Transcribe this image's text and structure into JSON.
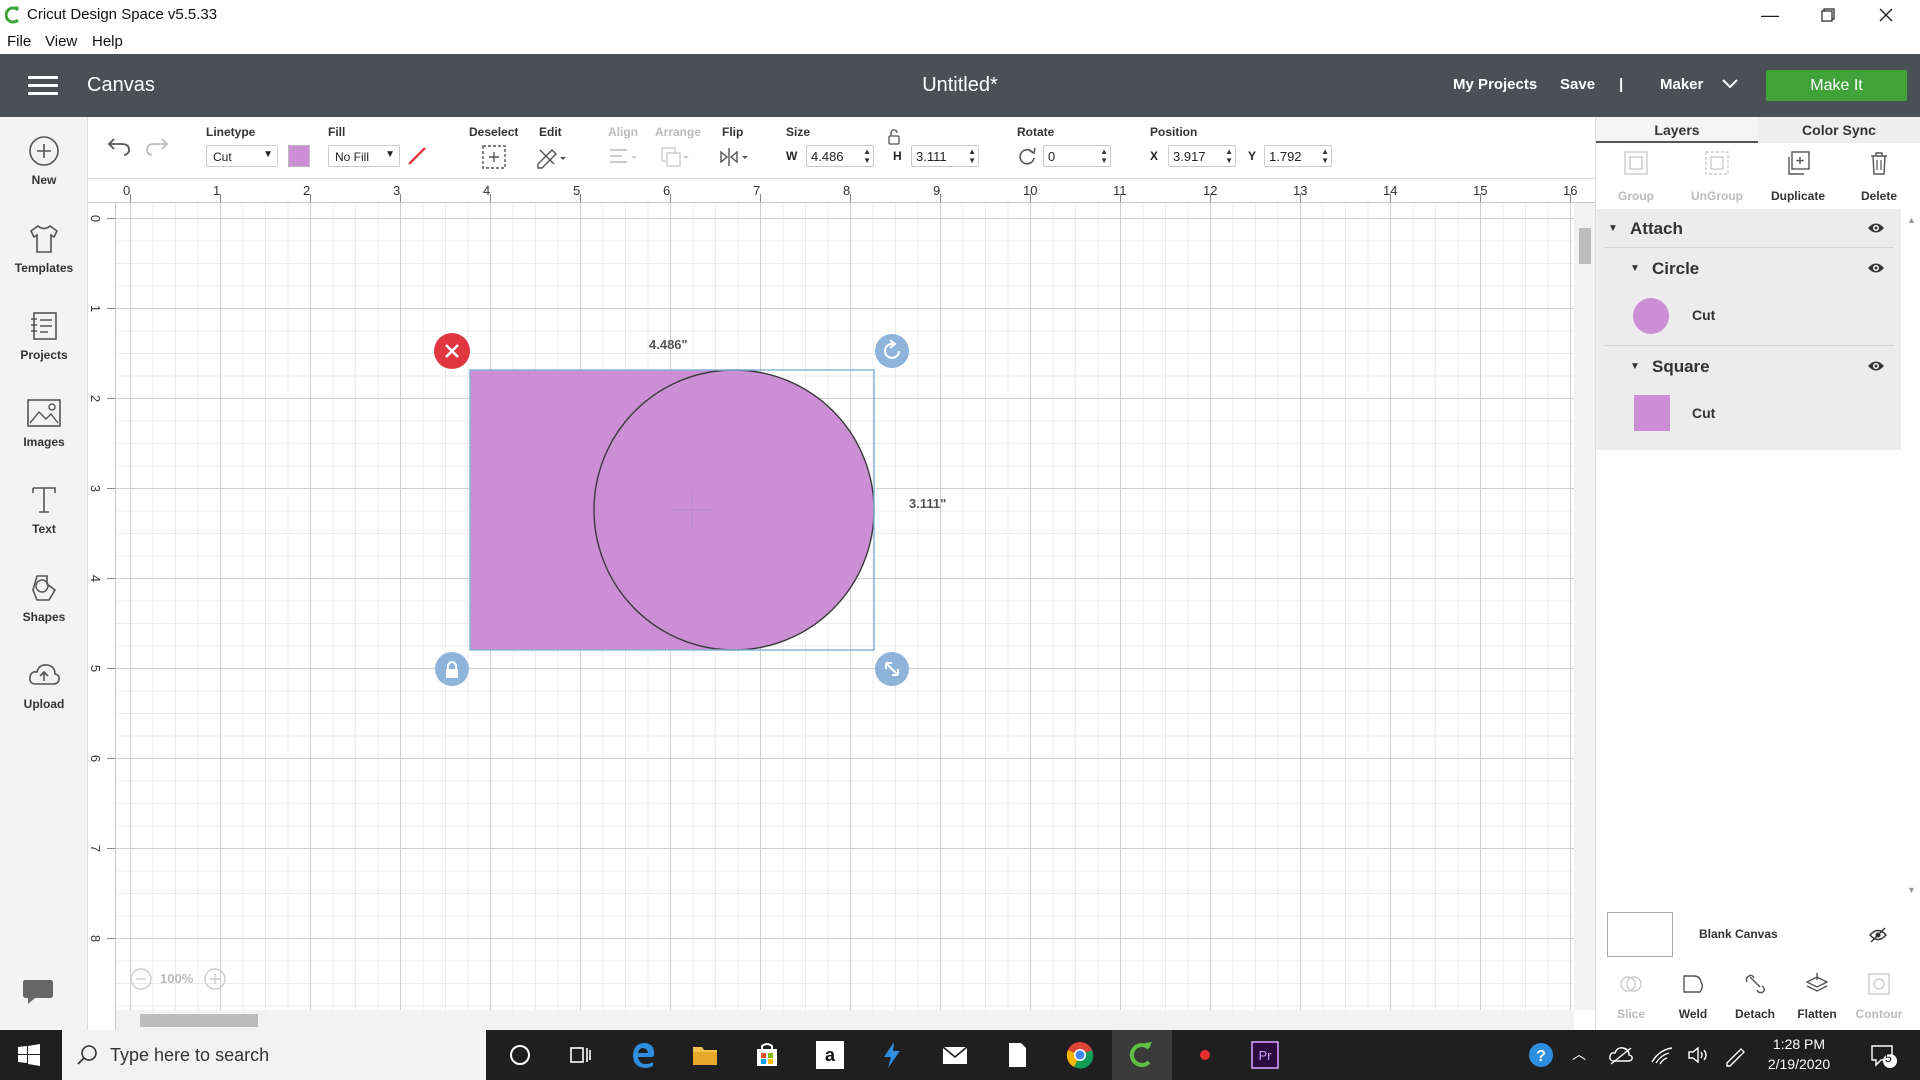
{
  "window": {
    "title": "Cricut Design Space  v5.5.33"
  },
  "menu": [
    "File",
    "View",
    "Help"
  ],
  "header": {
    "section": "Canvas",
    "doc_title": "Untitled*",
    "my_projects": "My Projects",
    "save": "Save",
    "separator": "|",
    "machine": "Maker",
    "make_it": "Make It",
    "make_it_color": "#3fa33a"
  },
  "sidebar": {
    "items": [
      {
        "label": "New",
        "icon": "plus-circle-icon"
      },
      {
        "label": "Templates",
        "icon": "tshirt-icon"
      },
      {
        "label": "Projects",
        "icon": "projects-icon"
      },
      {
        "label": "Images",
        "icon": "image-icon"
      },
      {
        "label": "Text",
        "icon": "text-icon"
      },
      {
        "label": "Shapes",
        "icon": "shapes-icon"
      },
      {
        "label": "Upload",
        "icon": "upload-icon"
      }
    ]
  },
  "toolbar": {
    "linetype_label": "Linetype",
    "linetype_value": "Cut",
    "fill_label": "Fill",
    "fill_value": "No Fill",
    "deselect_label": "Deselect",
    "edit_label": "Edit",
    "align_label": "Align",
    "arrange_label": "Arrange",
    "flip_label": "Flip",
    "size_label": "Size",
    "w_label": "W",
    "w_value": "4.486",
    "h_label": "H",
    "h_value": "3.111",
    "rotate_label": "Rotate",
    "rotate_value": "0",
    "position_label": "Position",
    "x_label": "X",
    "x_value": "3.917",
    "y_label": "Y",
    "y_value": "1.792",
    "swatch_color": "#cc8fd6"
  },
  "rulers": {
    "horizontal": [
      "0",
      "1",
      "2",
      "3",
      "4",
      "5",
      "6",
      "7",
      "8",
      "9",
      "10",
      "11",
      "12",
      "13",
      "14",
      "15",
      "16"
    ],
    "vertical": [
      "0",
      "1",
      "2",
      "3",
      "4",
      "5",
      "6",
      "7",
      "8"
    ]
  },
  "canvas": {
    "width_label": "4.486\"",
    "height_label": "3.111\"",
    "zoom": "100%",
    "shape_color": "#cc8fd6"
  },
  "right_panel": {
    "tabs": [
      "Layers",
      "Color Sync"
    ],
    "actions": [
      "Group",
      "UnGroup",
      "Duplicate",
      "Delete"
    ],
    "layers": {
      "group": "Attach",
      "items": [
        {
          "name": "Circle",
          "op": "Cut"
        },
        {
          "name": "Square",
          "op": "Cut"
        }
      ]
    },
    "blank_canvas": "Blank Canvas",
    "bottom_actions": [
      "Slice",
      "Weld",
      "Detach",
      "Flatten",
      "Contour"
    ]
  },
  "taskbar": {
    "search_placeholder": "Type here to search",
    "time": "1:28 PM",
    "date": "2/19/2020",
    "notifications": "5"
  }
}
